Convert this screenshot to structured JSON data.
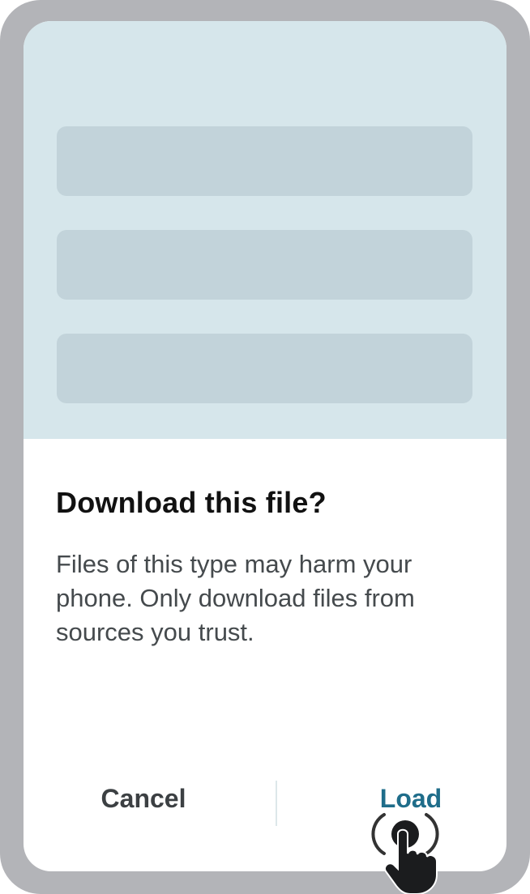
{
  "dialog": {
    "title": "Download this file?",
    "message": "Files of this type may harm your phone. Only download files from sources you trust.",
    "cancel_label": "Cancel",
    "load_label": "Load"
  },
  "icons": {
    "pointer": "tap-hand-icon"
  },
  "colors": {
    "device_frame": "#b3b4b8",
    "backdrop": "#d6e6eb",
    "placeholder": "#c2d3da",
    "accent": "#1f6d8a"
  }
}
